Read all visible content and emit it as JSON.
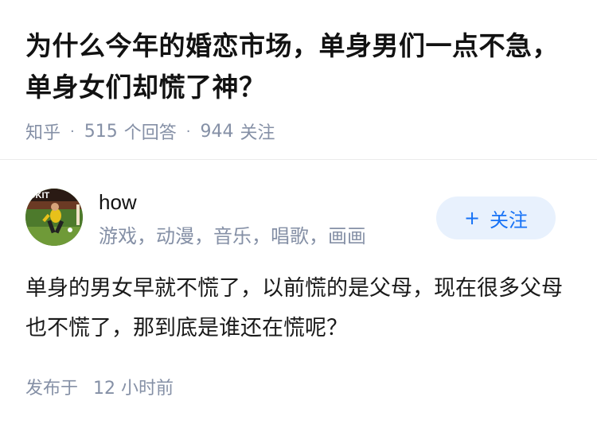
{
  "question": {
    "title": "为什么今年的婚恋市场，单身男们一点不急，单身女们却慌了神？",
    "source": "知乎",
    "answer_count": "515",
    "answer_label": "个回答",
    "follow_count": "944",
    "follow_label": "关注",
    "separator": "·"
  },
  "author": {
    "name": "how",
    "bio": "游戏，动漫，音乐，唱歌，画画",
    "follow_button": {
      "icon": "+",
      "label": "关注"
    },
    "avatar_text": "OKIT"
  },
  "answer": {
    "text": "单身的男女早就不慌了，以前慌的是父母，现在很多父母也不慌了，那到底是谁还在慌呢？"
  },
  "footer": {
    "published_label": "发布于",
    "published_time": "12 小时前"
  },
  "colors": {
    "accent": "#1772f6",
    "follow_bg": "#e8f1fd",
    "meta_gray": "#8590a6",
    "title": "#121212"
  }
}
